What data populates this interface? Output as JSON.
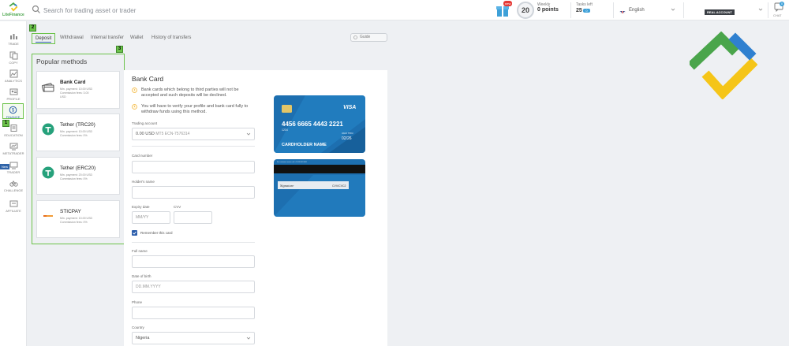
{
  "header": {
    "logo_text": "LiteFinance",
    "search_placeholder": "Search for trading asset or trader",
    "new_badge": "new",
    "level": "20",
    "weekly_label": "Weekly",
    "weekly_value": "0 points",
    "tasks_label": "Tasks left",
    "tasks_value": "25",
    "tasks_badge": "0",
    "language": "English",
    "account_type": "REAL ACCOUNT",
    "chat_label": "CHAT",
    "chat_count": "0"
  },
  "sidebar": {
    "items": [
      {
        "label": "TRADE",
        "icon": "trade-icon"
      },
      {
        "label": "COPY",
        "icon": "copy-icon"
      },
      {
        "label": "ANALYTICS",
        "icon": "analytics-icon"
      },
      {
        "label": "PROFILE",
        "icon": "profile-icon"
      },
      {
        "label": "FINANCE",
        "icon": "finance-icon"
      },
      {
        "label": "EDUCATION",
        "icon": "education-icon"
      },
      {
        "label": "METATRADER",
        "icon": "metatrader-icon"
      },
      {
        "label": "TRADER",
        "icon": "trader-icon"
      },
      {
        "label": "CHALLENGE",
        "icon": "challenge-icon"
      },
      {
        "label": "AFFILIATE",
        "icon": "affiliate-icon"
      }
    ],
    "new_badge": "New",
    "step_badge": "1"
  },
  "tabs": {
    "items": [
      "Deposit",
      "Withdrawal",
      "Internal transfer",
      "Wallet",
      "History of transfers"
    ],
    "active": "Deposit",
    "step_badge": "2"
  },
  "guide_label": "Guide",
  "methods": {
    "title": "Popular methods",
    "step_badge": "3",
    "items": [
      {
        "name": "Bank Card",
        "min": "Min. payment: 10.00 USD",
        "fee": "Commission fees: 3.00 USD"
      },
      {
        "name": "Tether (TRC20)",
        "min": "Min. payment: 10.00 USD",
        "fee": "Commission fees: 0%"
      },
      {
        "name": "Tether (ERC20)",
        "min": "Min. payment: 20.00 USD",
        "fee": "Commission fees: 0%"
      },
      {
        "name": "STICPAY",
        "min": "Min. payment: 10.00 USD",
        "fee": "Commission fees: 0%"
      }
    ]
  },
  "form": {
    "title": "Bank Card",
    "warning1": "Bank cards which belong to third parties will not be accepted and such deposits will be declined.",
    "warning2": "You will have to verify your profile and bank card fully to withdraw funds using this method.",
    "trading_account_label": "Trading account",
    "trading_account_value": "0.00 USD",
    "trading_account_number": "MT5 ECN-7576314",
    "card_number_label": "Card number",
    "holder_label": "Holder's name",
    "expiry_label": "Expiry date",
    "expiry_placeholder": "MM/YY",
    "cvv_label": "CVV",
    "remember_label": "Remember this card",
    "full_name_label": "Full name",
    "dob_label": "Date of birth",
    "dob_placeholder": "DD.MM.YYYY",
    "phone_label": "Phone",
    "country_label": "Country",
    "country_value": "Nigeria"
  },
  "card_preview": {
    "brand": "VISA",
    "number": "4456 6665 4443 2221",
    "small_number": "1234",
    "holder": "CARDHOLDER NAME",
    "valid_label": "VALID THRU",
    "expiry": "02/26",
    "signature": "Signature",
    "cvv_text": "CVV/CVC2",
    "back_top_text": "For customer service call +1 000 000 0000"
  },
  "colors": {
    "accent_green": "#6cc34a",
    "brand_blue": "#2b5dab",
    "card_blue": "#1d6fb0"
  }
}
